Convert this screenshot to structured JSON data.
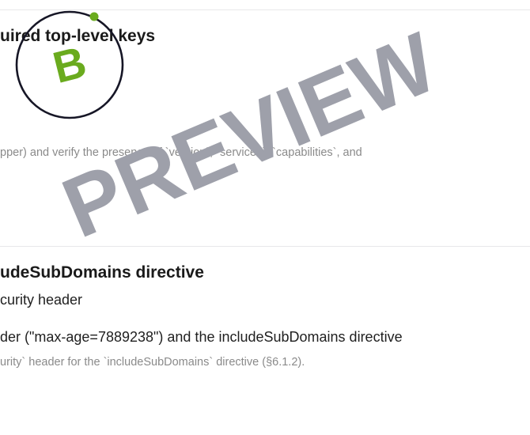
{
  "sections": [
    {
      "heading": "uired top-level keys",
      "note": "pper) and verify the presence of `version`, `services`, `capabilities`, and"
    },
    {
      "heading": "udeSubDomains directive",
      "subtitle": "curity header",
      "result": "der (\"max-age=7889238\") and the includeSubDomains directive",
      "description": "urity` header for the `includeSubDomains` directive (§6.1.2)."
    }
  ],
  "logo": {
    "letter": "B",
    "accent_color": "#6aab1e",
    "ring_color": "#161626"
  },
  "watermark": {
    "text": "PREVIEW",
    "color": "#9ea0aa"
  }
}
